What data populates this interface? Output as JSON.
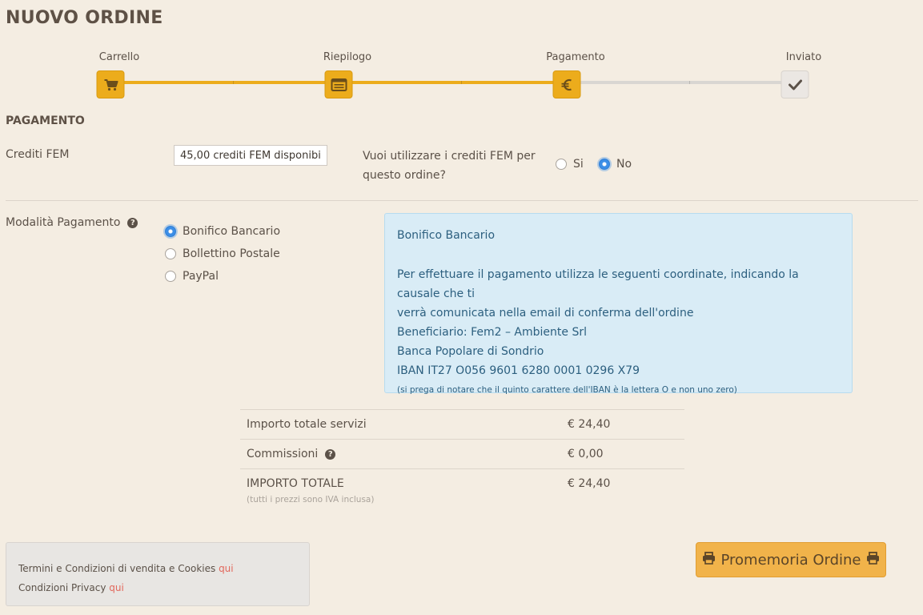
{
  "title": "NUOVO ORDINE",
  "steps": [
    {
      "label": "Carrello",
      "icon": "cart-icon",
      "state": "done"
    },
    {
      "label": "Riepilogo",
      "icon": "summary-icon",
      "state": "done"
    },
    {
      "label": "Pagamento",
      "icon": "euro-icon",
      "state": "done"
    },
    {
      "label": "Inviato",
      "icon": "check-icon",
      "state": "todo"
    }
  ],
  "section_title": "PAGAMENTO",
  "credits": {
    "label": "Crediti FEM",
    "value": "45,00 crediti FEM disponibili",
    "question": "Vuoi utilizzare i crediti FEM per questo ordine?",
    "options": [
      "Si",
      "No"
    ],
    "selected": "No"
  },
  "payment": {
    "label": "Modalità Pagamento",
    "help_icon": "?",
    "options": [
      "Bonifico Bancario",
      "Bollettino Postale",
      "PayPal"
    ],
    "selected": "Bonifico Bancario",
    "info": {
      "title": "Bonifico Bancario",
      "line1": "Per effettuare il pagamento utilizza le seguenti coordinate, indicando la causale che ti",
      "line2": "verrà comunicata nella email di conferma dell'ordine",
      "line3": "Beneficiario: Fem2 – Ambiente Srl",
      "line4": "Banca Popolare di Sondrio",
      "line5": "IBAN IT27 O056 9601 6280 0001 0296 X79",
      "note": "(si prega di notare che il quinto carattere dell'IBAN è la lettera O e non uno zero)"
    }
  },
  "summary": {
    "rows": [
      {
        "label": "Importo totale servizi",
        "value": "€ 24,40"
      },
      {
        "label": "Commissioni",
        "value": "€ 0,00"
      },
      {
        "label": "IMPORTO TOTALE",
        "value": "€ 24,40"
      }
    ],
    "vat_note": "(tutti i prezzi sono IVA inclusa)"
  },
  "footer": {
    "terms_text": "Termini e Condizioni di vendita e Cookies",
    "terms_link": "qui",
    "privacy_text": "Condizioni Privacy",
    "privacy_link": "qui"
  },
  "print_button": "Promemoria Ordine",
  "colors": {
    "accent": "#ecac1c",
    "info_bg": "#d9ecf6",
    "button": "#f1b34a",
    "link": "#e2685c"
  }
}
